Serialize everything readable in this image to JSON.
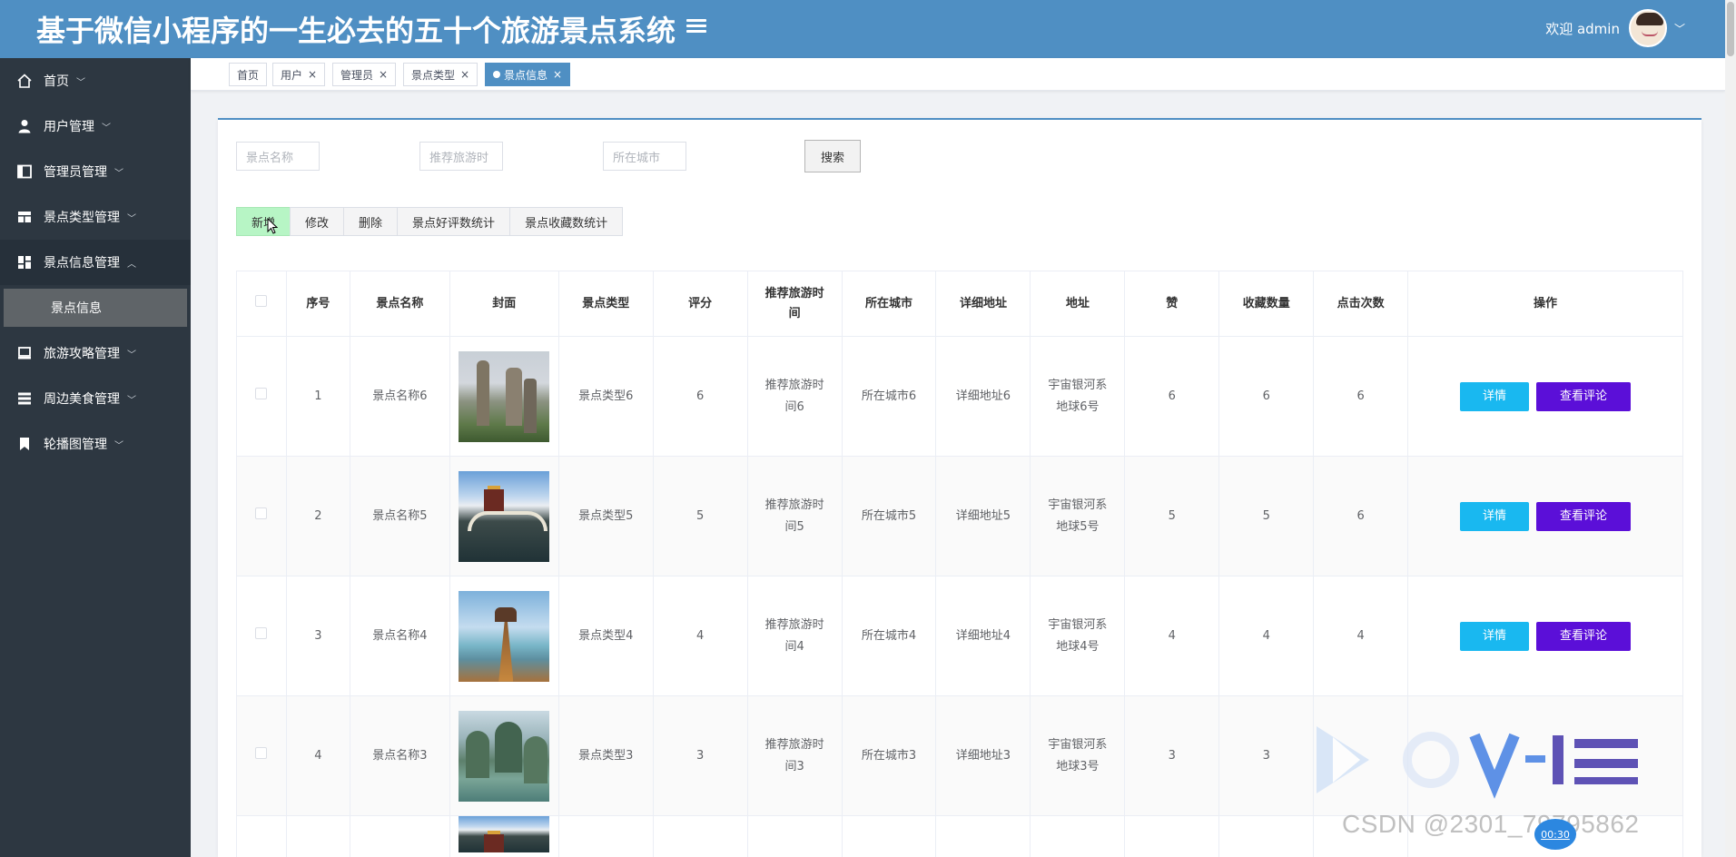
{
  "header": {
    "title": "基于微信小程序的一生必去的五十个旅游景点系统",
    "welcome": "欢迎 admin"
  },
  "sidebar": {
    "items": [
      {
        "label": "首页",
        "icon": "home-icon"
      },
      {
        "label": "用户管理",
        "icon": "user-icon"
      },
      {
        "label": "管理员管理",
        "icon": "panel-icon"
      },
      {
        "label": "景点类型管理",
        "icon": "table-icon"
      },
      {
        "label": "景点信息管理",
        "icon": "grid-icon"
      },
      {
        "label": "旅游攻略管理",
        "icon": "laptop-icon"
      },
      {
        "label": "周边美食管理",
        "icon": "list-icon"
      },
      {
        "label": "轮播图管理",
        "icon": "bookmark-icon"
      }
    ],
    "subitem": "景点信息"
  },
  "tags": [
    "首页",
    "用户",
    "管理员",
    "景点类型",
    "景点信息"
  ],
  "search": {
    "name_placeholder": "景点名称",
    "time_placeholder": "推荐旅游时",
    "city_placeholder": "所在城市",
    "button": "搜索"
  },
  "actions": {
    "add": "新增",
    "edit": "修改",
    "delete": "删除",
    "good_stats": "景点好评数统计",
    "fav_stats": "景点收藏数统计"
  },
  "table": {
    "headers": {
      "index": "序号",
      "name": "景点名称",
      "cover": "封面",
      "type": "景点类型",
      "score": "评分",
      "time_1": "推荐旅游时",
      "time_2": "间",
      "city": "所在城市",
      "detail_addr": "详细地址",
      "address": "地址",
      "likes": "赞",
      "favorites": "收藏数量",
      "clicks": "点击次数",
      "ops": "操作"
    },
    "rows": [
      {
        "index": "1",
        "name": "景点名称6",
        "type": "景点类型6",
        "score": "6",
        "time_1": "推荐旅游时",
        "time_2": "间6",
        "city": "所在城市6",
        "detail_addr": "详细地址6",
        "addr_1": "宇宙银河系",
        "addr_2": "地球6号",
        "likes": "6",
        "favorites": "6",
        "clicks": "6"
      },
      {
        "index": "2",
        "name": "景点名称5",
        "type": "景点类型5",
        "score": "5",
        "time_1": "推荐旅游时",
        "time_2": "间5",
        "city": "所在城市5",
        "detail_addr": "详细地址5",
        "addr_1": "宇宙银河系",
        "addr_2": "地球5号",
        "likes": "5",
        "favorites": "5",
        "clicks": "6"
      },
      {
        "index": "3",
        "name": "景点名称4",
        "type": "景点类型4",
        "score": "4",
        "time_1": "推荐旅游时",
        "time_2": "间4",
        "city": "所在城市4",
        "detail_addr": "详细地址4",
        "addr_1": "宇宙银河系",
        "addr_2": "地球4号",
        "likes": "4",
        "favorites": "4",
        "clicks": "4"
      },
      {
        "index": "4",
        "name": "景点名称3",
        "type": "景点类型3",
        "score": "3",
        "time_1": "推荐旅游时",
        "time_2": "间3",
        "city": "所在城市3",
        "detail_addr": "详细地址3",
        "addr_1": "宇宙银河系",
        "addr_2": "地球3号",
        "likes": "3",
        "favorites": "3",
        "clicks": ""
      }
    ],
    "detail_button": "详情",
    "comment_button": "查看评论"
  },
  "watermark": {
    "csdn": "CSDN @2301_79795862",
    "timer": "00:30"
  },
  "colors": {
    "header_bg": "#4f8fc3",
    "sidebar_bg": "#2d3741",
    "detail_btn": "#19b8f0",
    "comment_btn": "#5b0fd8",
    "add_btn": "#b7f5c5"
  }
}
